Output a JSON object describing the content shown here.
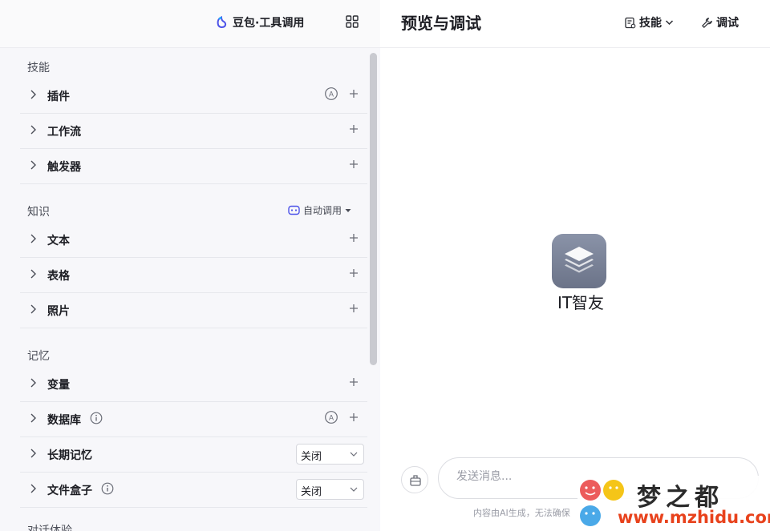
{
  "header": {
    "model_label": "豆包·工具调用",
    "preview_title": "预览与调试",
    "skills_button": "技能",
    "debug_button": "调试"
  },
  "sections": {
    "skills": {
      "title": "技能",
      "items": [
        {
          "label": "插件"
        },
        {
          "label": "工作流"
        },
        {
          "label": "触发器"
        }
      ]
    },
    "knowledge": {
      "title": "知识",
      "auto_call_label": "自动调用",
      "items": [
        {
          "label": "文本"
        },
        {
          "label": "表格"
        },
        {
          "label": "照片"
        }
      ]
    },
    "memory": {
      "title": "记忆",
      "items": [
        {
          "label": "变量"
        },
        {
          "label": "数据库"
        },
        {
          "label": "长期记忆",
          "select_value": "关闭"
        },
        {
          "label": "文件盒子",
          "select_value": "关闭"
        }
      ]
    },
    "dialog": {
      "title": "对话体验"
    }
  },
  "bot": {
    "name": "IT智友"
  },
  "chat": {
    "placeholder": "发送消息...",
    "disclaimer": "内容由AI生成，无法确保"
  },
  "watermark": {
    "brand": "梦之都",
    "url": "www.mzhidu.com"
  },
  "colors": {
    "accent_blue": "#4d53e8",
    "watermark_red": "#e8421c",
    "avatar": "#7a8296"
  }
}
